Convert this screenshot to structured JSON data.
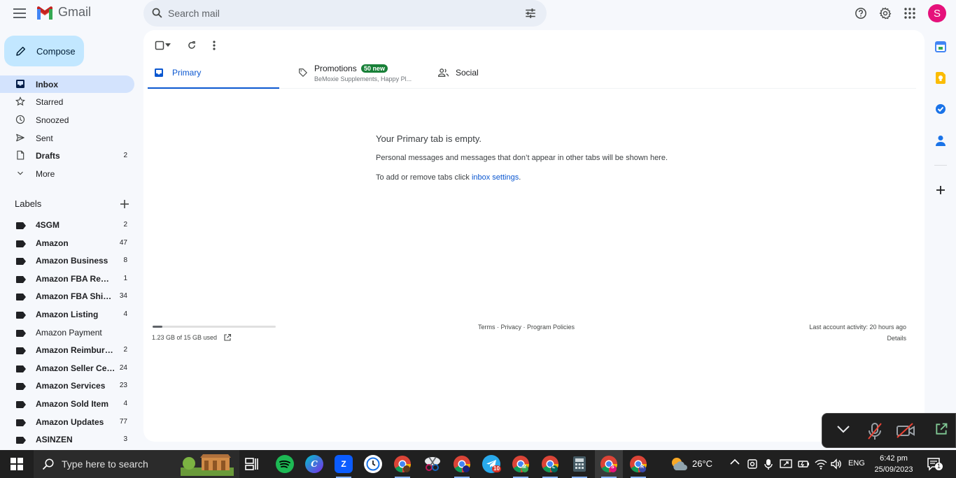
{
  "app": {
    "name": "Gmail"
  },
  "search": {
    "placeholder": "Search mail"
  },
  "account": {
    "initial": "S"
  },
  "compose": {
    "label": "Compose"
  },
  "nav": [
    {
      "label": "Inbox",
      "count": "",
      "active": true,
      "bold": true,
      "icon": "inbox-icon"
    },
    {
      "label": "Starred",
      "count": "",
      "icon": "star-icon"
    },
    {
      "label": "Snoozed",
      "count": "",
      "icon": "clock-icon"
    },
    {
      "label": "Sent",
      "count": "",
      "icon": "send-icon"
    },
    {
      "label": "Drafts",
      "count": "2",
      "bold": true,
      "icon": "draft-icon"
    },
    {
      "label": "More",
      "count": "",
      "icon": "chevron-down-icon"
    }
  ],
  "labels": {
    "heading": "Labels",
    "items": [
      {
        "name": "4SGM",
        "count": "2"
      },
      {
        "name": "Amazon",
        "count": "47"
      },
      {
        "name": "Amazon Business",
        "count": "8"
      },
      {
        "name": "Amazon FBA Removal",
        "count": "1"
      },
      {
        "name": "Amazon FBA Shipment",
        "count": "34"
      },
      {
        "name": "Amazon Listing",
        "count": "4"
      },
      {
        "name": "Amazon Payment",
        "count": "",
        "plain": true
      },
      {
        "name": "Amazon Reimbursement",
        "count": "2"
      },
      {
        "name": "Amazon Seller Central",
        "count": "24"
      },
      {
        "name": "Amazon Services",
        "count": "23"
      },
      {
        "name": "Amazon Sold Item",
        "count": "4"
      },
      {
        "name": "Amazon Updates",
        "count": "77"
      },
      {
        "name": "ASINZEN",
        "count": "3"
      }
    ]
  },
  "tabs": {
    "primary": {
      "label": "Primary"
    },
    "promotions": {
      "label": "Promotions",
      "badge": "50 new",
      "snippet": "BeMoxie Supplements, Happy Pl..."
    },
    "social": {
      "label": "Social"
    }
  },
  "empty": {
    "title": "Your Primary tab is empty.",
    "message": "Personal messages and messages that don’t appear in other tabs will be shown here.",
    "settings_prefix": "To add or remove tabs click ",
    "settings_link": "inbox settings",
    "settings_suffix": "."
  },
  "storage": {
    "text": "1.23 GB of 15 GB used",
    "used_fraction": 0.082
  },
  "footer": {
    "terms": "Terms",
    "privacy": "Privacy",
    "policies": "Program Policies",
    "separator": " · ",
    "last_activity": "Last account activity: 20 hours ago",
    "details": "Details"
  },
  "taskbar": {
    "search_placeholder": "Type here to search",
    "temperature": "26°C",
    "language": "ENG",
    "time": "6:42 pm",
    "date": "25/09/2023",
    "notification_count": "1",
    "telegram_badge": "10",
    "profile_letters": [
      "M",
      "L",
      "S",
      "R"
    ]
  },
  "colors": {
    "accent": "#0b57d0",
    "compose_bg": "#c2e7ff",
    "active_nav": "#d3e3fd",
    "promo_badge": "#188038",
    "avatar": "#e5117b"
  }
}
